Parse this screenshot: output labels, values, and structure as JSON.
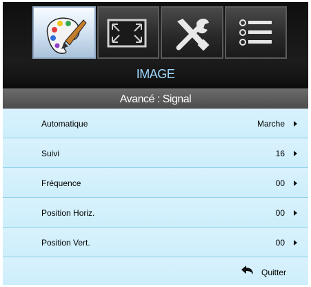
{
  "tabs": [
    {
      "icon": "palette-icon",
      "active": true
    },
    {
      "icon": "screen-resize-icon",
      "active": false
    },
    {
      "icon": "tools-icon",
      "active": false
    },
    {
      "icon": "options-list-icon",
      "active": false
    }
  ],
  "header": {
    "title": "IMAGE",
    "subtitle": "Avancé : Signal"
  },
  "rows": [
    {
      "label": "Automatique",
      "value": "Marche"
    },
    {
      "label": "Suivi",
      "value": "16"
    },
    {
      "label": "Fréquence",
      "value": "00"
    },
    {
      "label": "Position Horiz.",
      "value": "00"
    },
    {
      "label": "Position Vert.",
      "value": "00"
    }
  ],
  "footer": {
    "quit_label": "Quitter",
    "quit_icon": "return-arrow-icon"
  },
  "colors": {
    "row_bg": "#d2effb",
    "row_separator": "#8ecfe6",
    "title_text": "#9fd8ff",
    "header_bg": "#151515",
    "subheader_bg": "#555555"
  }
}
